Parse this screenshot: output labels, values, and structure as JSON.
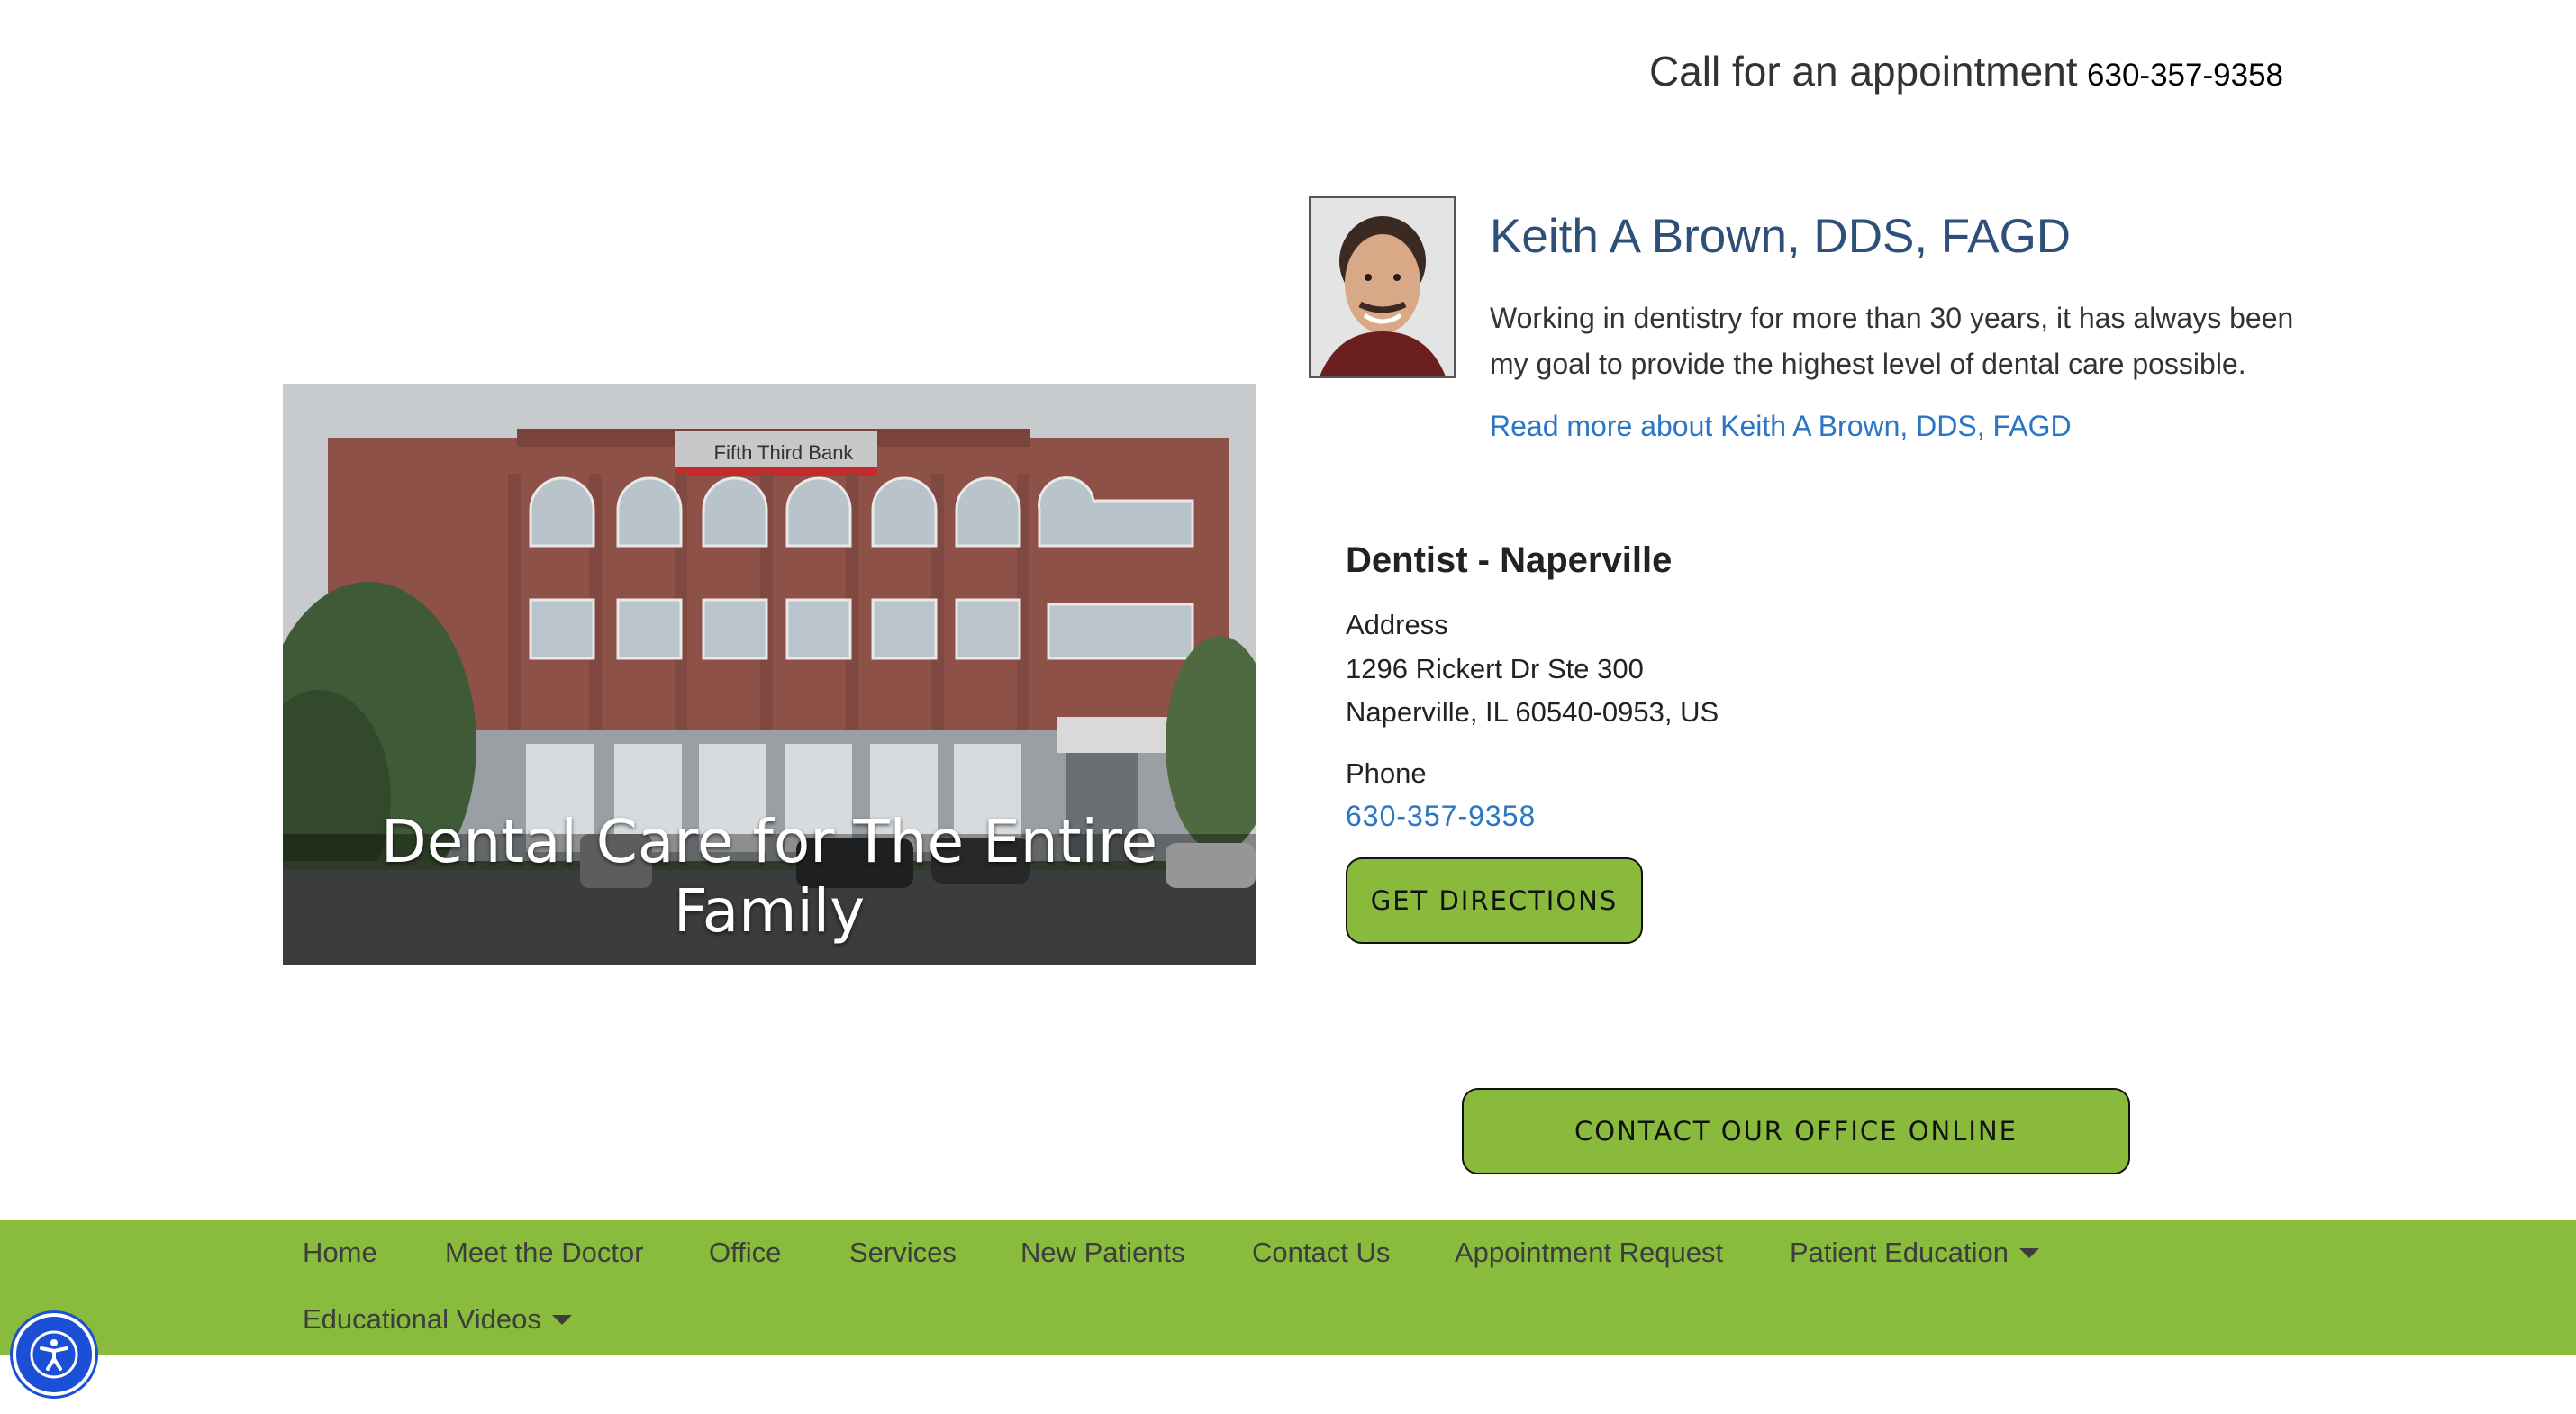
{
  "header": {
    "cta_text": "Call for an appointment",
    "phone": "630-357-9358"
  },
  "hero": {
    "caption": "Dental Care for The Entire Family",
    "building_sign": "Fifth Third Bank"
  },
  "doctor": {
    "name": "Keith A Brown, DDS, FAGD",
    "description": "Working in dentistry for more than 30 years, it has always been my goal to provide the highest level of dental care possible.",
    "read_more": "Read more about Keith A Brown, DDS, FAGD"
  },
  "location": {
    "title": "Dentist - Naperville",
    "address_label": "Address",
    "address_line1": "1296 Rickert Dr Ste 300",
    "address_line2": "Naperville, IL 60540-0953, US",
    "phone_label": "Phone",
    "phone": "630-357-9358",
    "directions_button": "GET DIRECTIONS"
  },
  "contact_button": "CONTACT OUR OFFICE ONLINE",
  "nav": {
    "items": [
      {
        "label": "Home"
      },
      {
        "label": "Meet the Doctor"
      },
      {
        "label": "Office"
      },
      {
        "label": "Services"
      },
      {
        "label": "New Patients"
      },
      {
        "label": "Contact Us"
      },
      {
        "label": "Appointment Request"
      },
      {
        "label": "Patient Education",
        "dropdown": true
      },
      {
        "label": "Educational Videos",
        "dropdown": true
      }
    ]
  },
  "colors": {
    "accent_green": "#8aba3c",
    "link_blue": "#2a76c5",
    "heading_blue": "#2e4f77",
    "a11y_blue": "#1a4fd6"
  },
  "icons": {
    "accessibility": "accessibility-icon",
    "dropdown": "caret-down-icon"
  }
}
